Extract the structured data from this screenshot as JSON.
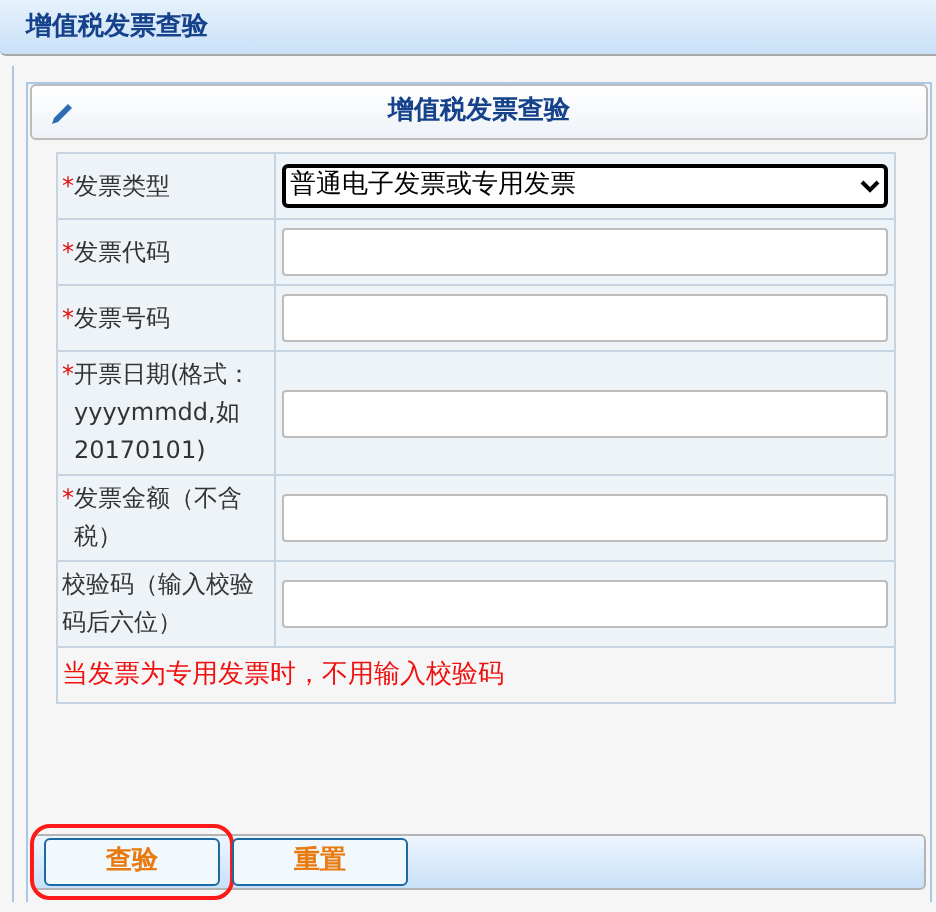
{
  "window": {
    "title": "增值税发票查验"
  },
  "panel": {
    "title": "增值税发票查验"
  },
  "form": {
    "fields": [
      {
        "kind": "select",
        "mark": "*",
        "label": "发票类型",
        "value": "普通电子发票或专用发票"
      },
      {
        "kind": "input",
        "mark": "*",
        "label": "发票代码"
      },
      {
        "kind": "input",
        "mark": "*",
        "label": "发票号码"
      },
      {
        "kind": "input",
        "mark": "*",
        "label": "开票日期(格式：yyyymmdd,如20170101)"
      },
      {
        "kind": "input",
        "mark": "*",
        "label": "发票金额（不含税）"
      },
      {
        "kind": "input",
        "label": "校验码（输入校验码后六位）"
      }
    ],
    "note": "当发票为专用发票时，不用输入校验码"
  },
  "buttons": [
    {
      "label": "查验",
      "highlighted": true
    },
    {
      "label": "重置",
      "highlighted": false
    }
  ]
}
